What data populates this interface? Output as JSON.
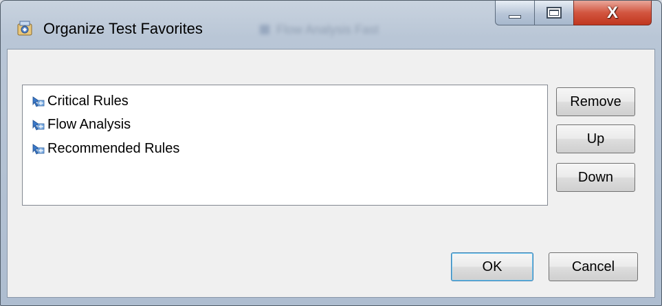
{
  "window": {
    "title": "Organize Test Favorites",
    "background_title": "Flow Analysis Fast",
    "controls": {
      "minimize_icon": "minimize-icon",
      "maximize_icon": "maximize-icon",
      "close_label": "X"
    }
  },
  "favorites": {
    "items": [
      {
        "label": "Critical Rules",
        "icon": "test-config-icon"
      },
      {
        "label": "Flow Analysis",
        "icon": "test-config-icon"
      },
      {
        "label": "Recommended Rules",
        "icon": "test-config-icon"
      }
    ]
  },
  "side_buttons": {
    "remove": "Remove",
    "up": "Up",
    "down": "Down"
  },
  "footer": {
    "ok": "OK",
    "cancel": "Cancel"
  },
  "colors": {
    "close_button": "#c9432b",
    "client_background": "#f0f0f0",
    "default_button_border": "#3c7fb1"
  }
}
